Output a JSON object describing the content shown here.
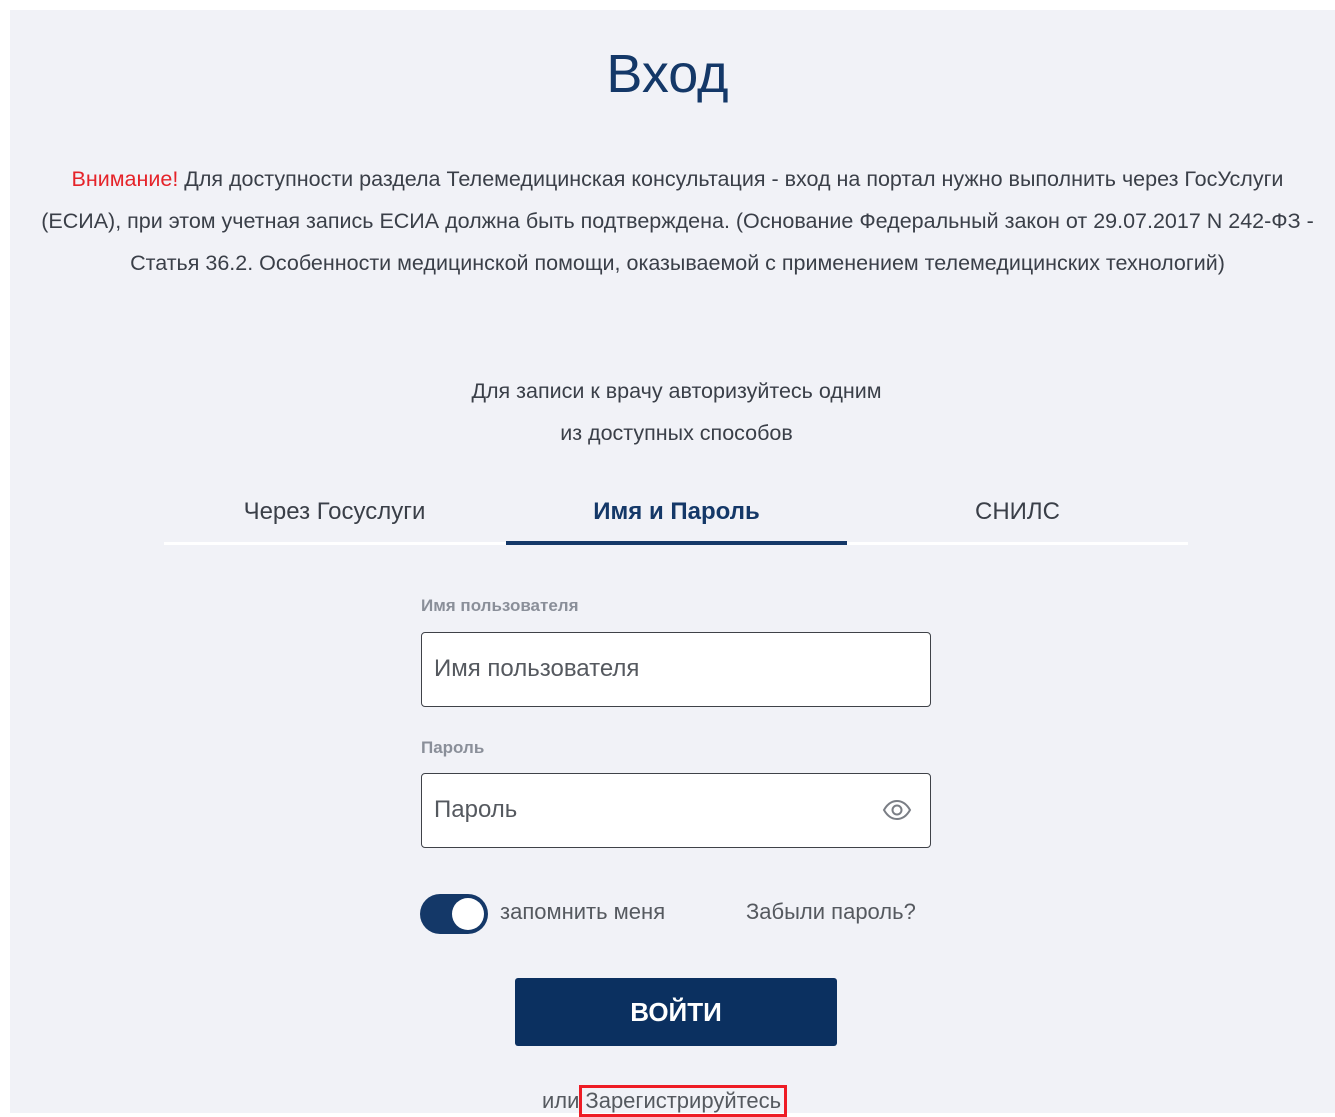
{
  "page": {
    "title": "Вход"
  },
  "notice": {
    "warning_label": "Внимание!",
    "text": " Для доступности раздела Телемедицинская консультация - вход на портал нужно выполнить через ГосУслуги (ЕСИА), при этом учетная запись ЕСИА должна быть подтверждена. (Основание Федеральный закон от 29.07.2017 N 242-ФЗ - Статья 36.2. Особенности медицинской помощи, оказываемой с применением телемедицинских технологий)"
  },
  "subtitle": {
    "line1": "Для записи к врачу авторизуйтесь одним",
    "line2": "из доступных способов"
  },
  "tabs": [
    {
      "label": "Через Госуслуги",
      "active": false
    },
    {
      "label": "Имя и Пароль",
      "active": true
    },
    {
      "label": "СНИЛС",
      "active": false
    }
  ],
  "form": {
    "username": {
      "label": "Имя пользователя",
      "placeholder": "Имя пользователя",
      "value": ""
    },
    "password": {
      "label": "Пароль",
      "placeholder": "Пароль",
      "value": "",
      "toggle_icon": "eye-icon"
    },
    "remember": {
      "label": "запомнить меня",
      "checked": true
    },
    "forgot_label": "Забыли пароль?",
    "submit_label": "ВОЙТИ",
    "register_prefix": "или",
    "register_label": "Зарегистрируйтесь"
  },
  "colors": {
    "brand": "#143868",
    "button": "#0b3060",
    "warning": "#e52329",
    "highlight": "#ee1c25",
    "panel_bg": "#f1f2f7"
  }
}
